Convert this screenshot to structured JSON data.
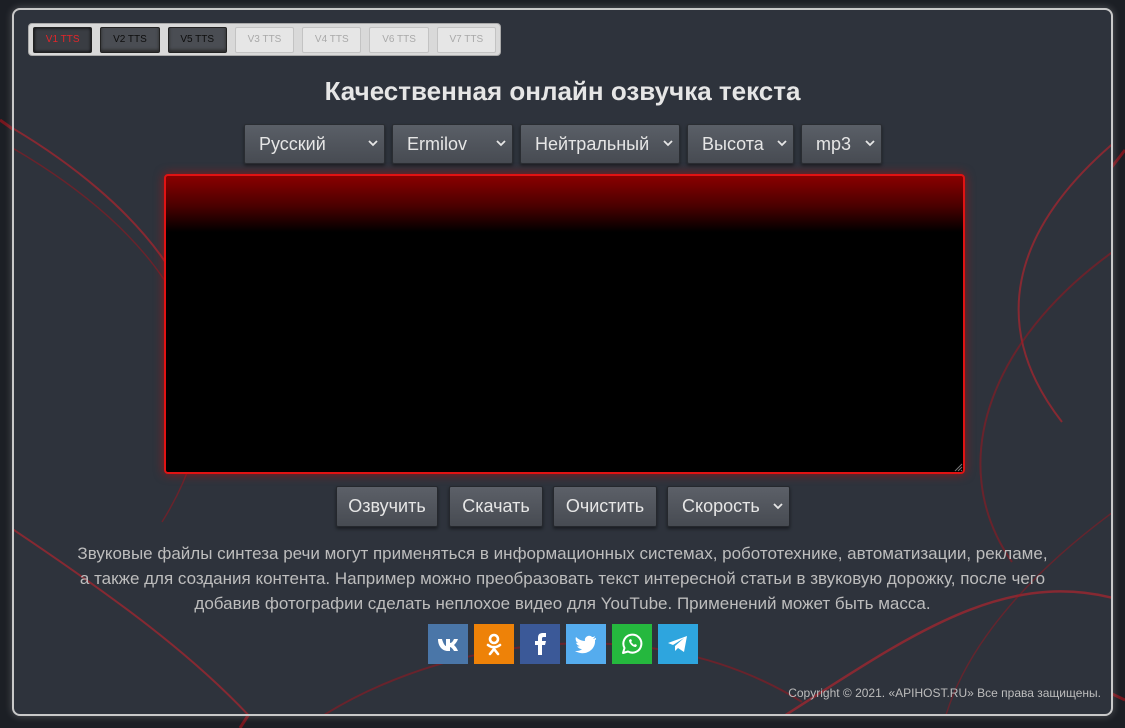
{
  "version_tabs": [
    {
      "label": "V1 TTS",
      "state": "active"
    },
    {
      "label": "V2 TTS",
      "state": "dark"
    },
    {
      "label": "V5 TTS",
      "state": "dark"
    },
    {
      "label": "V3 TTS",
      "state": "disabled"
    },
    {
      "label": "V4 TTS",
      "state": "disabled"
    },
    {
      "label": "V6 TTS",
      "state": "disabled"
    },
    {
      "label": "V7 TTS",
      "state": "disabled"
    }
  ],
  "title": "Качественная онлайн озвучка текста",
  "selects": {
    "language": "Русский",
    "voice": "Ermilov",
    "emotion": "Нейтральный",
    "pitch": "Высота",
    "format": "mp3",
    "speed": "Скорость"
  },
  "text_input": {
    "value": "",
    "placeholder": ""
  },
  "buttons": {
    "speak": "Озвучить",
    "download": "Скачать",
    "clear": "Очистить"
  },
  "description": "Звуковые файлы синтеза речи могут применяться в информационных системах, робототехнике, автоматизации, рекламе, а также для создания контента. Например можно преобразовать текст интересной статьи в звуковую дорожку, после чего добавив фотографии сделать неплохое видео для YouTube. Применений может быть масса.",
  "social": [
    {
      "name": "vk-icon",
      "color": "#4a76a8",
      "glyph": "вк"
    },
    {
      "name": "odnoklassniki-icon",
      "color": "#ee8208",
      "glyph": "ok"
    },
    {
      "name": "facebook-icon",
      "color": "#3b5998",
      "glyph": "f"
    },
    {
      "name": "twitter-icon",
      "color": "#55acee",
      "glyph": "bird"
    },
    {
      "name": "whatsapp-icon",
      "color": "#25b83e",
      "glyph": "wa"
    },
    {
      "name": "telegram-icon",
      "color": "#2ea5de",
      "glyph": "tg"
    }
  ],
  "copyright": "Copyright © 2021. «APIHOST.RU» Все права защищены.",
  "colors": {
    "accent_red": "#e01313",
    "panel_bg": "#2e333c",
    "page_bg": "#1c1f25"
  }
}
